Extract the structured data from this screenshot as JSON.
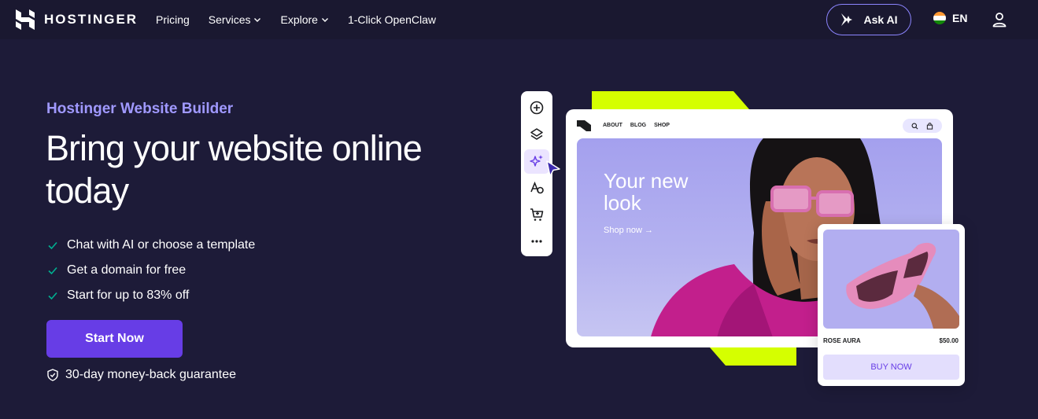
{
  "header": {
    "brand": "HOSTINGER",
    "nav": [
      {
        "label": "Pricing",
        "has_dropdown": false
      },
      {
        "label": "Services",
        "has_dropdown": true
      },
      {
        "label": "Explore",
        "has_dropdown": true
      },
      {
        "label": "1-Click OpenClaw",
        "has_dropdown": false
      }
    ],
    "ask_ai_label": "Ask AI",
    "language": "EN"
  },
  "hero": {
    "eyebrow": "Hostinger Website Builder",
    "headline": "Bring your website online today",
    "features": [
      "Chat with AI or choose a template",
      "Get a domain for free",
      "Start for up to 83% off"
    ],
    "cta_label": "Start Now",
    "guarantee": "30-day money-back guarantee"
  },
  "preview": {
    "site_nav": [
      "ABOUT",
      "BLOG",
      "SHOP"
    ],
    "hero_title": "Your new look",
    "hero_link": "Shop now →",
    "product_name": "ROSE AURA",
    "product_price": "$50.00",
    "buy_label": "BUY NOW"
  },
  "colors": {
    "background": "#1d1b38",
    "accent_purple": "#673de6",
    "eyebrow_purple": "#a099ff",
    "lime": "#d5ff00",
    "check_green": "#00b090"
  },
  "icons": {
    "toolbar": [
      "plus-circle-icon",
      "layers-icon",
      "ai-sparkle-icon",
      "typography-icon",
      "cart-icon",
      "more-icon"
    ]
  }
}
